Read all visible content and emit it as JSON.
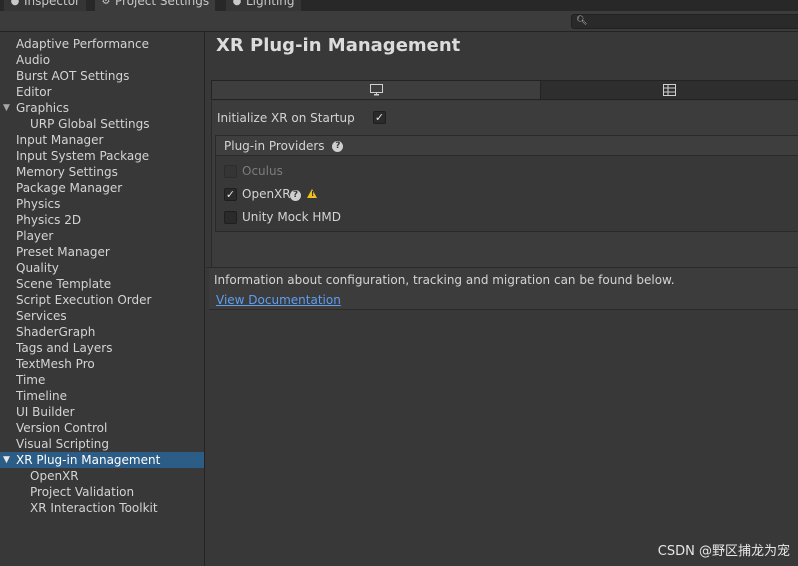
{
  "tabs": [
    {
      "label": "Inspector",
      "icon": "info-icon"
    },
    {
      "label": "Project Settings",
      "icon": "gear-icon"
    },
    {
      "label": "Lighting",
      "icon": "bulb-icon"
    }
  ],
  "search": {
    "placeholder": "",
    "icon": "search-icon"
  },
  "sidebar": {
    "items": [
      {
        "label": "Adaptive Performance"
      },
      {
        "label": "Audio"
      },
      {
        "label": "Burst AOT Settings"
      },
      {
        "label": "Editor"
      },
      {
        "label": "Graphics"
      },
      {
        "label": "URP Global Settings"
      },
      {
        "label": "Input Manager"
      },
      {
        "label": "Input System Package"
      },
      {
        "label": "Memory Settings"
      },
      {
        "label": "Package Manager"
      },
      {
        "label": "Physics"
      },
      {
        "label": "Physics 2D"
      },
      {
        "label": "Player"
      },
      {
        "label": "Preset Manager"
      },
      {
        "label": "Quality"
      },
      {
        "label": "Scene Template"
      },
      {
        "label": "Script Execution Order"
      },
      {
        "label": "Services"
      },
      {
        "label": "ShaderGraph"
      },
      {
        "label": "Tags and Layers"
      },
      {
        "label": "TextMesh Pro"
      },
      {
        "label": "Time"
      },
      {
        "label": "Timeline"
      },
      {
        "label": "UI Builder"
      },
      {
        "label": "Version Control"
      },
      {
        "label": "Visual Scripting"
      },
      {
        "label": "XR Plug-in Management"
      },
      {
        "label": "OpenXR"
      },
      {
        "label": "Project Validation"
      },
      {
        "label": "XR Interaction Toolkit"
      }
    ]
  },
  "main": {
    "title": "XR Plug-in Management",
    "platform_tabs": [
      {
        "icon": "desktop-icon",
        "active": true
      },
      {
        "icon": "android-grid-icon",
        "active": false
      }
    ],
    "init_label": "Initialize XR on Startup",
    "init_checked": true,
    "providers": {
      "title": "Plug-in Providers",
      "items": [
        {
          "label": "Oculus",
          "checked": false,
          "disabled": true
        },
        {
          "label": "OpenXR",
          "checked": true,
          "disabled": false
        },
        {
          "label": "Unity Mock HMD",
          "checked": false,
          "disabled": false
        }
      ]
    },
    "info_text": "Information about configuration, tracking and migration can be found below.",
    "doc_link": "View Documentation"
  },
  "watermark": "CSDN @野区捕龙为宠",
  "colors": {
    "background": "#383838",
    "selection": "#2c5d87",
    "link": "#5e9ef2",
    "warning": "#f0c020"
  }
}
